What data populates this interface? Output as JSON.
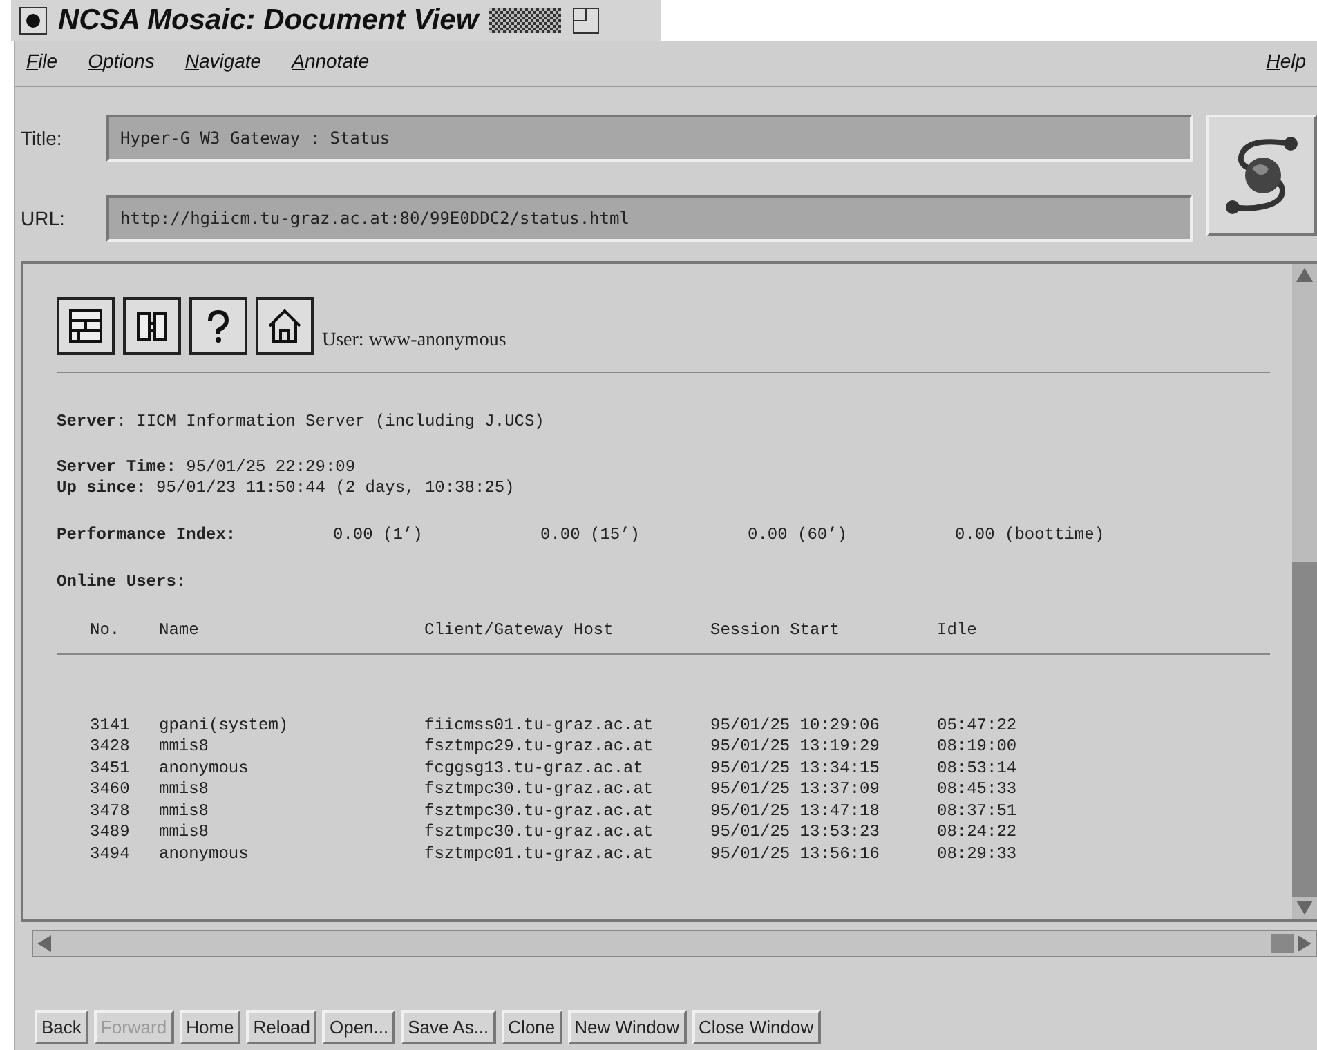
{
  "window": {
    "title": "NCSA Mosaic: Document View"
  },
  "menu": [
    {
      "label": "File"
    },
    {
      "label": "Options"
    },
    {
      "label": "Navigate"
    },
    {
      "label": "Annotate"
    }
  ],
  "help_menu": {
    "label": "Help"
  },
  "title_field": {
    "label": "Title:",
    "value": "Hyper-G W3 Gateway : Status"
  },
  "url_field": {
    "label": "URL:",
    "value": "http://hgiicm.tu-graz.ac.at:80/99E0DDC2/status.html"
  },
  "document": {
    "user": "User: www-anonymous",
    "server": {
      "label": "Server",
      "value": ": IICM Information Server (including J.UCS)"
    },
    "server_time": {
      "label": "Server Time:",
      "value": "95/01/25 22:29:09"
    },
    "up_since": {
      "label": "Up since:",
      "value": "95/01/23 11:50:44 (2 days, 10:38:25)"
    },
    "performance": {
      "label": "Performance Index:",
      "values": [
        "0.00 (1’)",
        "0.00 (15’)",
        "0.00 (60’)",
        "0.00 (boottime)"
      ]
    },
    "online_users": {
      "label": "Online Users:"
    },
    "table": {
      "columns": [
        "No.",
        "Name",
        "Client/Gateway Host",
        "Session Start",
        "Idle"
      ],
      "rows": [
        [
          "3141",
          "gpani(system)",
          "fiicmss01.tu-graz.ac.at",
          "95/01/25 10:29:06",
          "05:47:22"
        ],
        [
          "3428",
          "mmis8",
          "fsztmpc29.tu-graz.ac.at",
          "95/01/25 13:19:29",
          "08:19:00"
        ],
        [
          "3451",
          "anonymous",
          "fcggsg13.tu-graz.ac.at",
          "95/01/25 13:34:15",
          "08:53:14"
        ],
        [
          "3460",
          "mmis8",
          "fsztmpc30.tu-graz.ac.at",
          "95/01/25 13:37:09",
          "08:45:33"
        ],
        [
          "3478",
          "mmis8",
          "fsztmpc30.tu-graz.ac.at",
          "95/01/25 13:47:18",
          "08:37:51"
        ],
        [
          "3489",
          "mmis8",
          "fsztmpc30.tu-graz.ac.at",
          "95/01/25 13:53:23",
          "08:24:22"
        ],
        [
          "3494",
          "anonymous",
          "fsztmpc01.tu-graz.ac.at",
          "95/01/25 13:56:16",
          "08:29:33"
        ]
      ]
    }
  },
  "buttons": [
    {
      "label": "Back",
      "disabled": false
    },
    {
      "label": "Forward",
      "disabled": true
    },
    {
      "label": "Home",
      "disabled": false
    },
    {
      "label": "Reload",
      "disabled": false
    },
    {
      "label": "Open...",
      "disabled": false
    },
    {
      "label": "Save As...",
      "disabled": false
    },
    {
      "label": "Clone",
      "disabled": false
    },
    {
      "label": "New Window",
      "disabled": false
    },
    {
      "label": "Close Window",
      "disabled": false
    }
  ]
}
